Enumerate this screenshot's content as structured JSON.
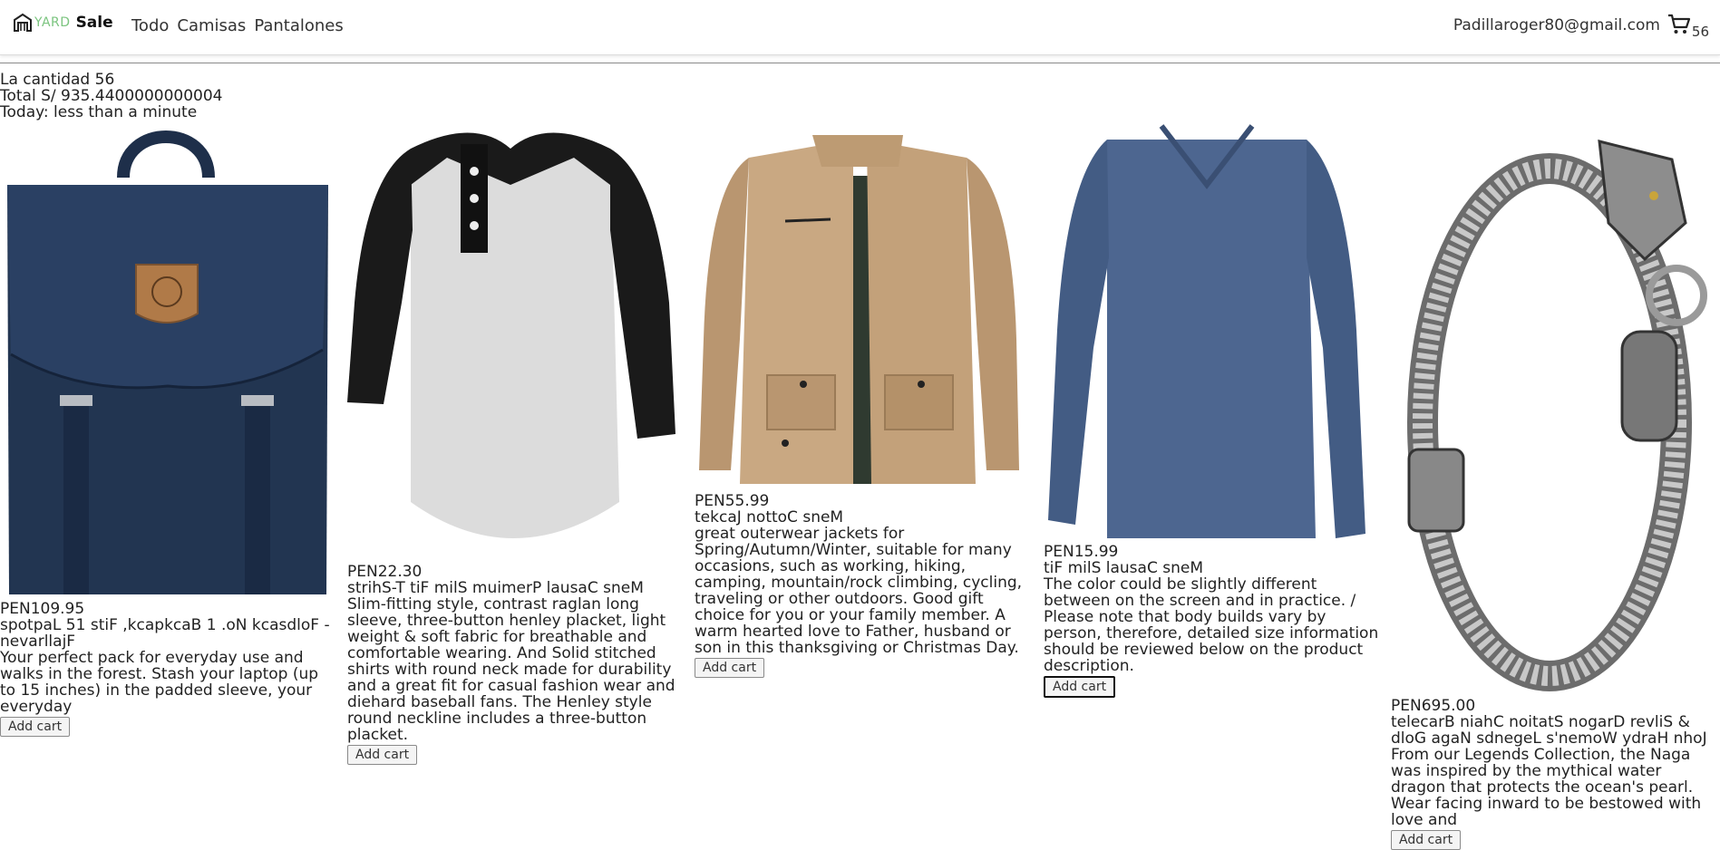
{
  "navbar": {
    "brand_yard": "YARD",
    "brand_sale": "Sale",
    "links": [
      "Todo",
      "Camisas",
      "Pantalones"
    ],
    "user_email": "Padillaroger80@gmail.com",
    "cart_count": "56"
  },
  "summary": {
    "cantidad": "La cantidad 56",
    "total": "Total S/ 935.4400000000004",
    "today": "Today: less than a minute"
  },
  "products": [
    {
      "image": "backpack",
      "price": "PEN109.95",
      "title": "spotpaL 51 stiF ,kcapkcaB 1 .oN kcasdloF - nevarllajF",
      "description": "Your perfect pack for everyday use and walks in the forest. Stash your laptop (up to 15 inches) in the padded sleeve, your everyday",
      "button": "Add cart"
    },
    {
      "image": "henley-shirt",
      "price": "PEN22.30",
      "title": "strihS-T tiF milS muimerP lausaC sneM",
      "description": "Slim-fitting style, contrast raglan long sleeve, three-button henley placket, light weight & soft fabric for breathable and comfortable wearing. And Solid stitched shirts with round neck made for durability and a great fit for casual fashion wear and diehard baseball fans. The Henley style round neckline includes a three-button placket.",
      "button": "Add cart"
    },
    {
      "image": "cotton-jacket",
      "price": "PEN55.99",
      "title": "tekcaJ nottoC sneM",
      "description": "great outerwear jackets for Spring/Autumn/Winter, suitable for many occasions, such as working, hiking, camping, mountain/rock climbing, cycling, traveling or other outdoors. Good gift choice for you or your family member. A warm hearted love to Father, husband or son in this thanksgiving or Christmas Day.",
      "button": "Add cart"
    },
    {
      "image": "slim-fit-tee",
      "price": "PEN15.99",
      "title": "tiF milS lausaC sneM",
      "description": "The color could be slightly different between on the screen and in practice. / Please note that body builds vary by person, therefore, detailed size information should be reviewed below on the product description.",
      "button": "Add cart"
    },
    {
      "image": "dragon-bracelet",
      "price": "PEN695.00",
      "title": "telecarB niahC noitatS nogarD revliS & dloG agaN sdnegeL s'nemoW ydraH nhoJ",
      "description": "From our Legends Collection, the Naga was inspired by the mythical water dragon that protects the ocean's pearl. Wear facing inward to be bestowed with love and",
      "button": "Add cart"
    }
  ],
  "colors": {
    "brand_yard": "#7bc47f",
    "backpack": "#223551",
    "jacket": "#c9a882",
    "tee": "#4d6690"
  }
}
